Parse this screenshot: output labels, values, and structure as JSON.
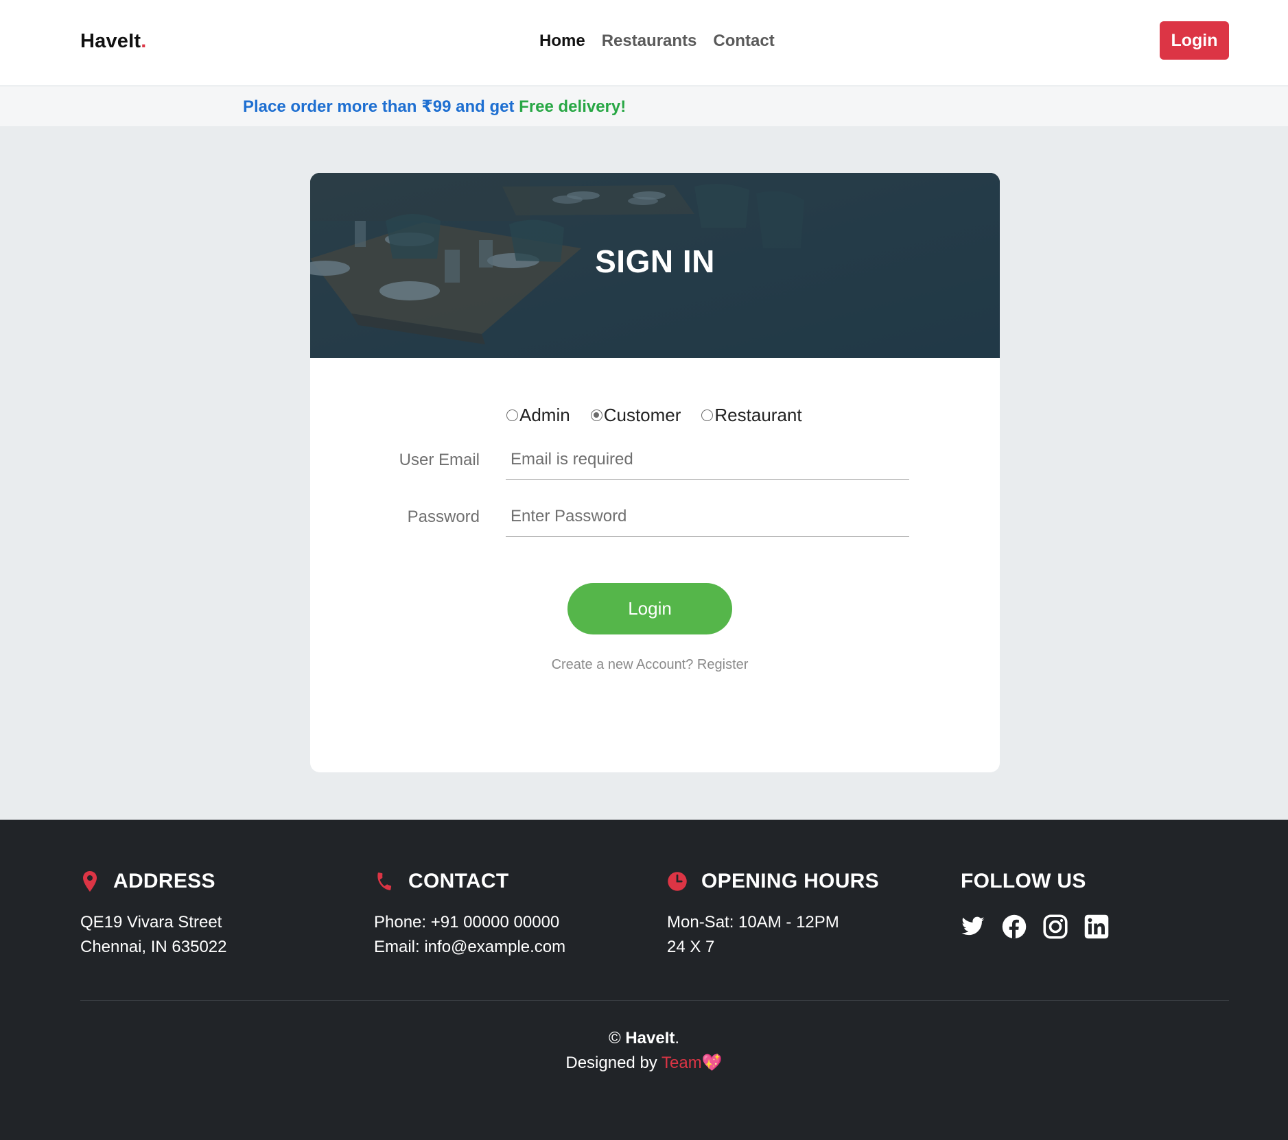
{
  "nav": {
    "brand": "HaveIt",
    "brand_dot": ".",
    "links": [
      "Home",
      "Restaurants",
      "Contact"
    ],
    "login_label": "Login"
  },
  "promo": {
    "text_start": "Place order more than ₹99 and get ",
    "highlight": "Free delivery",
    "text_end": "!"
  },
  "signin": {
    "title": "SIGN IN",
    "roles": [
      "Admin",
      "Customer",
      "Restaurant"
    ],
    "selected_role": "Customer",
    "email_label": "User Email",
    "email_placeholder": "Email is required",
    "password_label": "Password",
    "password_placeholder": "Enter Password",
    "login_button": "Login",
    "register_text": "Create a new Account? Register"
  },
  "footer": {
    "address": {
      "title": "ADDRESS",
      "lines": [
        "QE19 Vivara Street",
        "Chennai, IN 635022"
      ],
      "icon": "map-pin-icon"
    },
    "contact": {
      "title": "CONTACT",
      "lines": [
        "Phone: +91 00000 00000",
        "Email: info@example.com"
      ],
      "icon": "phone-icon"
    },
    "hours": {
      "title": "OPENING HOURS",
      "lines": [
        "Mon-Sat: 10AM - 12PM",
        "24 X 7"
      ],
      "icon": "clock-icon"
    },
    "follow": {
      "title": "FOLLOW US",
      "icons": [
        "twitter-icon",
        "facebook-icon",
        "instagram-icon",
        "linkedin-icon"
      ]
    },
    "copyright_symbol": "©",
    "copyright_brand": "HaveIt",
    "copyright_dot": ".",
    "designed_by": "Designed by ",
    "team": "Team",
    "heart": "💖"
  },
  "colors": {
    "accent_red": "#dc3545",
    "promo_blue": "#1e6fd1",
    "promo_green": "#28a745",
    "login_green": "#55b64a",
    "footer_bg": "#212428"
  }
}
